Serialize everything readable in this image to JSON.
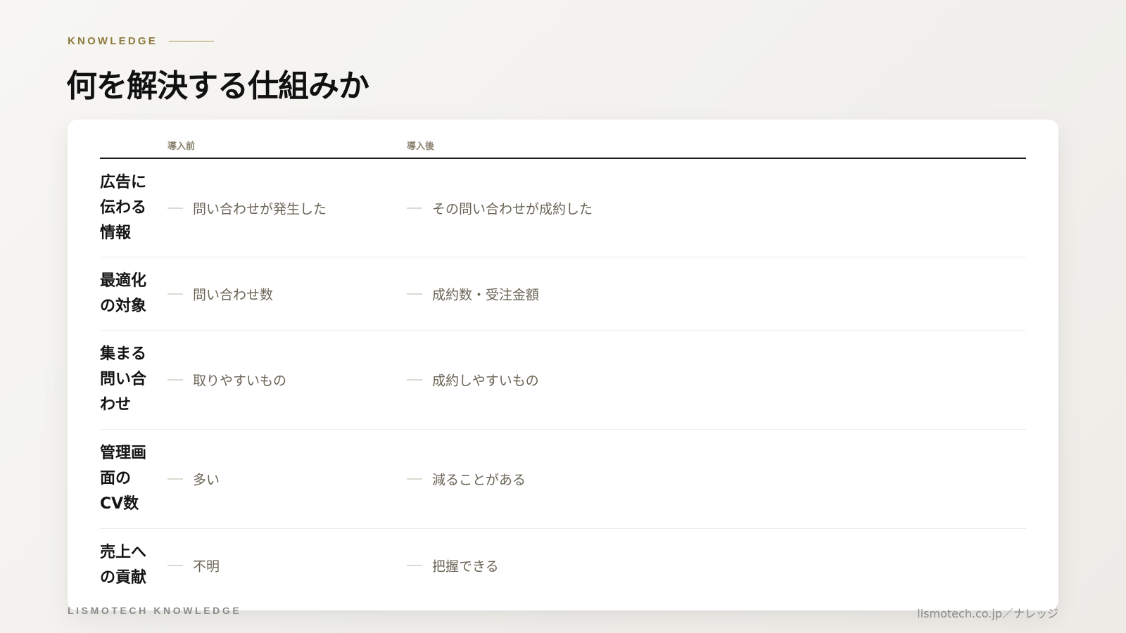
{
  "header": {
    "eyebrow": "KNOWLEDGE",
    "title": "何を解決する仕組みか"
  },
  "table": {
    "columns": {
      "before": "導入前",
      "after": "導入後"
    },
    "rows": [
      {
        "label": "広告に伝わる情報",
        "before": "問い合わせが発生した",
        "after": "その問い合わせが成約した"
      },
      {
        "label": "最適化の対象",
        "before": "問い合わせ数",
        "after": "成約数・受注金額"
      },
      {
        "label": "集まる問い合わせ",
        "before": "取りやすいもの",
        "after": "成約しやすいもの"
      },
      {
        "label": "管理画面のCV数",
        "before": "多い",
        "after": "減ることがある"
      },
      {
        "label": "売上への貢献",
        "before": "不明",
        "after": "把握できる"
      }
    ]
  },
  "footer": {
    "left": "LISMOTECH KNOWLEDGE",
    "right": "lismotech.co.jp／ナレッジ"
  }
}
